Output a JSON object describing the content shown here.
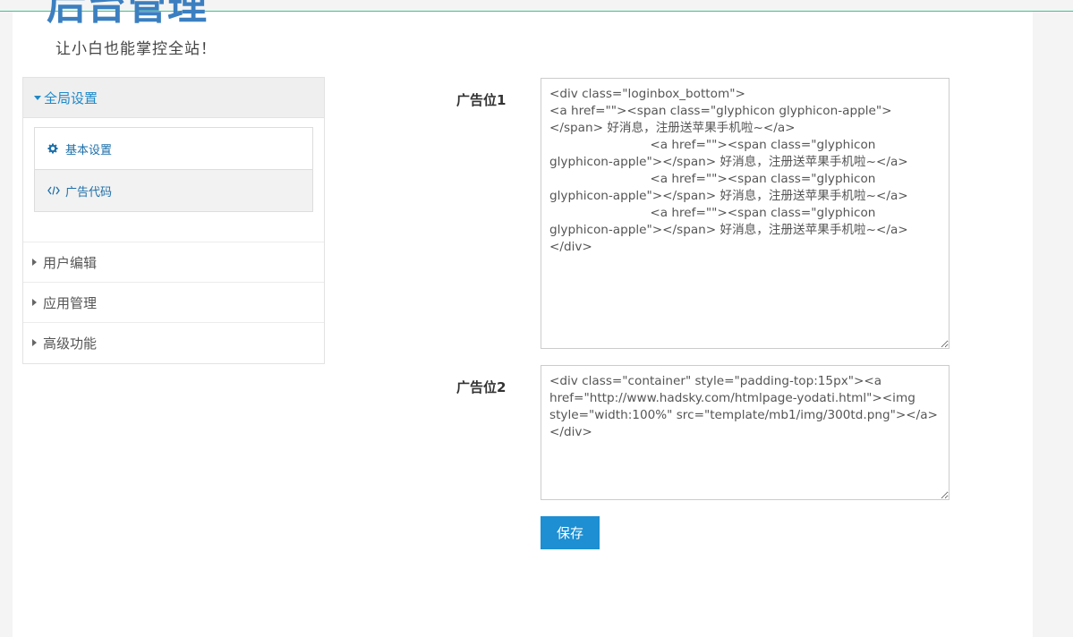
{
  "logo": {
    "title": "后台管理",
    "slogan": "让小白也能掌控全站！"
  },
  "sidebar": {
    "group": {
      "label": "全局设置",
      "items": [
        {
          "label": "基本设置",
          "icon": "gear-icon"
        },
        {
          "label": "广告代码",
          "icon": "code-icon"
        }
      ]
    },
    "menu": [
      {
        "label": "用户编辑"
      },
      {
        "label": "应用管理"
      },
      {
        "label": "高级功能"
      }
    ]
  },
  "form": {
    "ad1": {
      "label": "广告位1",
      "value": "<div class=\"loginbox_bottom\">\n<a href=\"\"><span class=\"glyphicon glyphicon-apple\"></span> 好消息，注册送苹果手机啦~</a>\n                          <a href=\"\"><span class=\"glyphicon glyphicon-apple\"></span> 好消息，注册送苹果手机啦~</a>\n                          <a href=\"\"><span class=\"glyphicon glyphicon-apple\"></span> 好消息，注册送苹果手机啦~</a>\n                          <a href=\"\"><span class=\"glyphicon glyphicon-apple\"></span> 好消息，注册送苹果手机啦~</a>\n</div>"
    },
    "ad2": {
      "label": "广告位2",
      "value": "<div class=\"container\" style=\"padding-top:15px\"><a href=\"http://www.hadsky.com/htmlpage-yodati.html\"><img style=\"width:100%\" src=\"template/mb1/img/300td.png\"></a>\n</div>"
    },
    "save_label": "保存"
  },
  "colors": {
    "accent": "#1e88c8",
    "button": "#1d8fd2",
    "top_border": "#34c88f"
  }
}
